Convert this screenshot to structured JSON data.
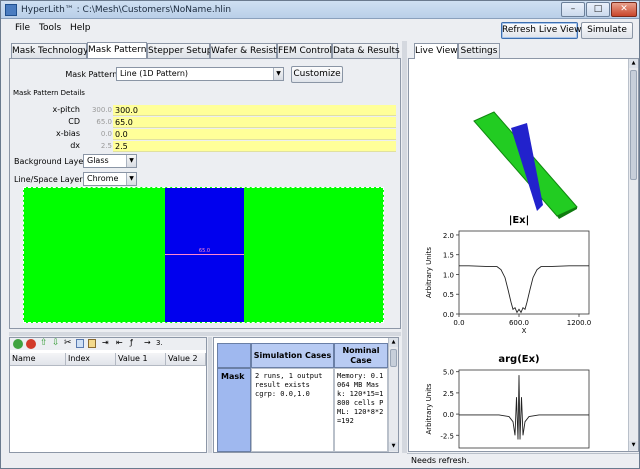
{
  "window": {
    "title": "HyperLith™ : C:\\Mesh\\Customers\\NoName.hlin",
    "min_label": "–",
    "max_label": "□",
    "close_label": "✕"
  },
  "menu": {
    "file": "File",
    "tools": "Tools",
    "help": "Help"
  },
  "toolbar": {
    "refresh_label": "Refresh Live View",
    "simulate_label": "Simulate"
  },
  "tabs": [
    {
      "label": "Mask Technology"
    },
    {
      "label": "Mask Pattern"
    },
    {
      "label": "Stepper Setup"
    },
    {
      "label": "Wafer & Resist"
    },
    {
      "label": "FEM Control"
    },
    {
      "label": "Data & Results"
    }
  ],
  "mask_pattern": {
    "label": "Mask Pattern:",
    "selected": "Line (1D Pattern)",
    "customize_label": "Customize",
    "details_title": "Mask Pattern Details",
    "fields": [
      {
        "label": "x-pitch",
        "default": "300.0",
        "value": "300.0"
      },
      {
        "label": "CD",
        "default": "65.0",
        "value": "65.0"
      },
      {
        "label": "x-bias",
        "default": "0.0",
        "value": "0.0"
      },
      {
        "label": "dx",
        "default": "2.5",
        "value": "2.5"
      }
    ],
    "background_layer_label": "Background Layer",
    "background_layer_value": "Glass",
    "line_space_layer_label": "Line/Space Layer",
    "line_space_layer_value": "Chrome",
    "dimension_label": "65.0",
    "colors": {
      "glass": "#00ff00",
      "chrome": "#0000ee",
      "dimension": "#ff88cc"
    }
  },
  "param_table": {
    "tool_more": "3.",
    "columns": [
      "Name",
      "Index",
      "Value 1",
      "Value 2"
    ]
  },
  "sim_table": {
    "col1": "Simulation Cases",
    "col2": "Nominal Case Details",
    "row_header": "Mask",
    "cases_text": "2 runs, 1 output result exists cgrp: 0.0,1.0",
    "details_text": "Memory: 0.1064 MB Mask: 120*15=1800 cells PML: 120*8*2=192"
  },
  "right_tabs": [
    {
      "label": "Live View"
    },
    {
      "label": "Settings"
    }
  ],
  "charts": [
    {
      "title": "|Ex|",
      "ylabel": "Arbitrary Units",
      "xlabel": "X",
      "xticks": [
        "0.0",
        "600.0",
        "1200.0"
      ],
      "yticks": [
        "0.0",
        "0.5",
        "1.0",
        "1.5",
        "2.0"
      ]
    },
    {
      "title": "arg(Ex)",
      "ylabel": "Arbitrary Units",
      "yticks": [
        "5.0",
        "2.5",
        "0.0",
        "-2.5"
      ]
    }
  ],
  "chart_data": [
    {
      "type": "line",
      "title": "|Ex|",
      "xlabel": "X",
      "ylabel": "Arbitrary Units",
      "xlim": [
        0,
        1300
      ],
      "ylim": [
        0,
        2.1
      ],
      "x": [
        0,
        100,
        200,
        300,
        380,
        420,
        460,
        490,
        520,
        540,
        560,
        580,
        600,
        620,
        640,
        660,
        680,
        710,
        740,
        780,
        820,
        900,
        1000,
        1100,
        1200,
        1300
      ],
      "y": [
        1.22,
        1.22,
        1.21,
        1.2,
        1.2,
        1.12,
        0.92,
        0.62,
        0.3,
        0.12,
        0.16,
        0.04,
        0.12,
        0.04,
        0.16,
        0.12,
        0.3,
        0.62,
        0.92,
        1.12,
        1.2,
        1.2,
        1.21,
        1.22,
        1.22,
        1.22
      ]
    },
    {
      "type": "line",
      "title": "arg(Ex)",
      "ylabel": "Arbitrary Units",
      "xlim": [
        0,
        1300
      ],
      "ylim": [
        -4,
        5.2
      ],
      "x": [
        0,
        200,
        400,
        500,
        540,
        560,
        575,
        590,
        600,
        610,
        625,
        640,
        660,
        700,
        800,
        1000,
        1300
      ],
      "y": [
        -0.1,
        -0.1,
        -0.1,
        -0.3,
        -0.9,
        -2.5,
        2.0,
        -3.0,
        4.6,
        -3.0,
        2.0,
        -2.5,
        -0.9,
        -0.3,
        -0.1,
        -0.1,
        -0.1
      ]
    }
  ]
}
